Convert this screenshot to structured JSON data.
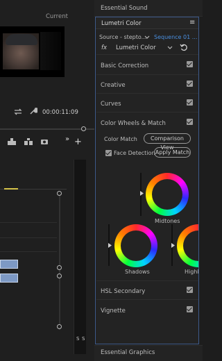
{
  "program_monitor": {
    "label": "Current",
    "timecode": "00:00:11:09"
  },
  "timeline": {
    "s_labels": [
      "S",
      "S"
    ]
  },
  "panels": {
    "essential_sound": "Essential Sound",
    "lumetri_title": "Lumetri Color",
    "menu_glyph": "≡",
    "source_label": "Source - stepto...",
    "sequence_label": "Sequence 01 ...",
    "fx_label": "fx",
    "effect_select": "Lumetri Color",
    "essential_graphics": "Essential Graphics"
  },
  "sections": {
    "basic_correction": "Basic Correction",
    "creative": "Creative",
    "curves": "Curves",
    "color_wheels": "Color Wheels & Match",
    "hsl_secondary": "HSL Secondary",
    "vignette": "Vignette"
  },
  "color_match": {
    "label": "Color Match",
    "comparison_view": "Comparison View",
    "face_detection": "Face Detection",
    "apply_match": "Apply Match"
  },
  "wheels": {
    "midtones": "Midtones",
    "shadows": "Shadows",
    "highlights": "Highli"
  }
}
